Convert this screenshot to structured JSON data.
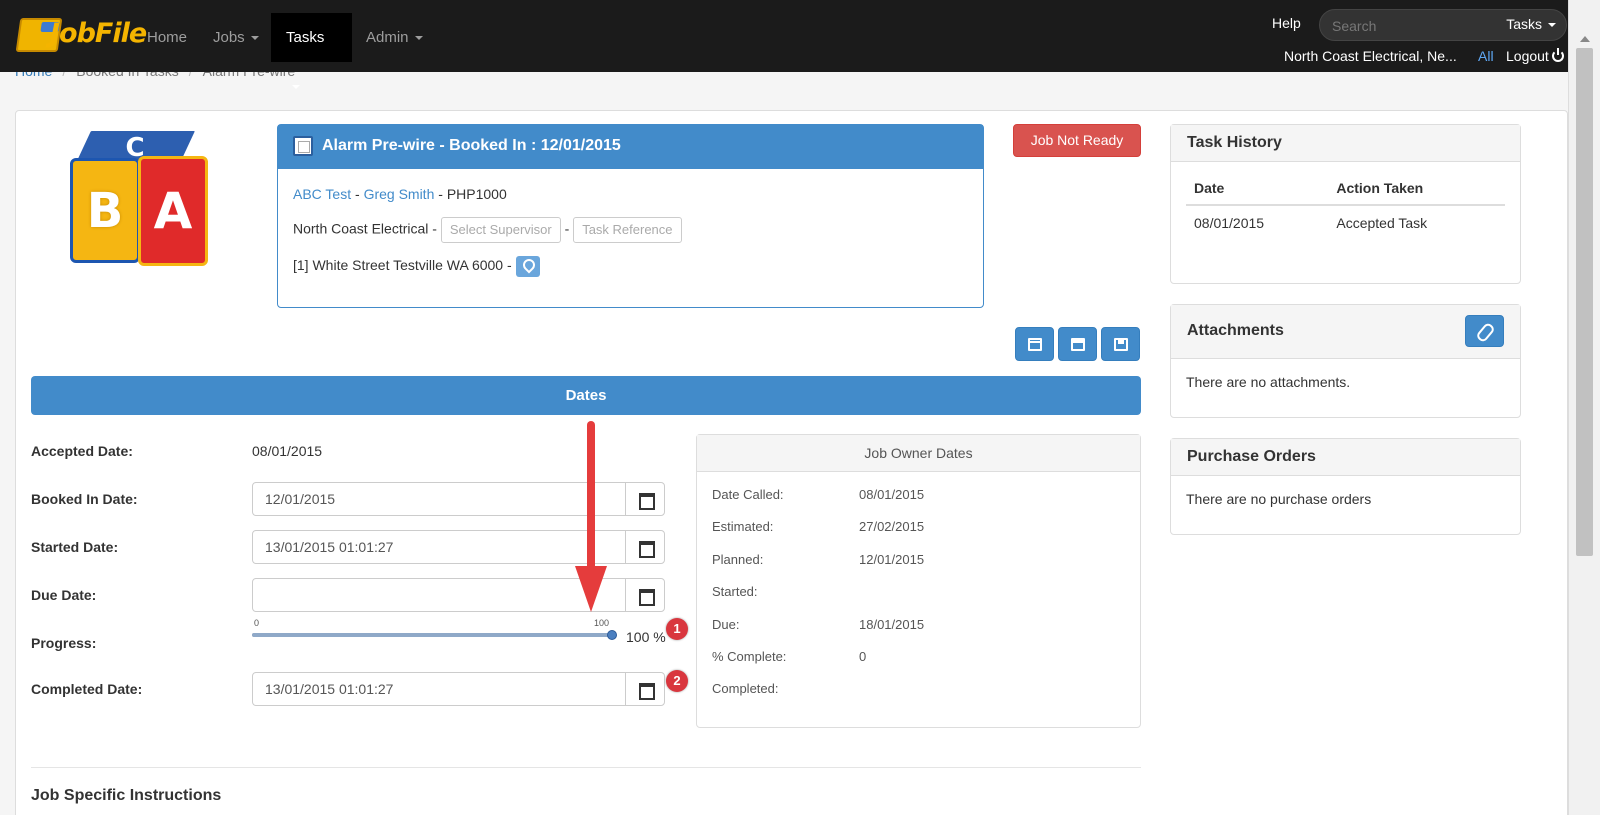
{
  "navbar": {
    "brand": "JobFile",
    "items": [
      {
        "label": "Home",
        "dropdown": false
      },
      {
        "label": "Jobs",
        "dropdown": true
      },
      {
        "label": "Tasks",
        "dropdown": true,
        "active": true
      },
      {
        "label": "Admin",
        "dropdown": true
      }
    ],
    "help": "Help",
    "search_placeholder": "Search",
    "search_scope": "Tasks",
    "company": "North Coast Electrical, Ne...",
    "all_link": "All",
    "logout": "Logout"
  },
  "breadcrumb": [
    "Home",
    "Booked In Tasks",
    "Alarm Pre-wire"
  ],
  "task": {
    "title": "Alarm Pre-wire - Booked In : 12/01/2015",
    "client": "ABC Test",
    "contact": "Greg Smith",
    "code": "PHP1000",
    "company": "North Coast Electrical",
    "supervisor_placeholder": "Select Supervisor",
    "reference_placeholder": "Task Reference",
    "address": "[1] White Street Testville WA 6000",
    "logo_letters": {
      "top": "C",
      "left": "B",
      "right": "A"
    }
  },
  "status_button": "Job Not Ready",
  "toolbar_icons": [
    "calendar-icon",
    "print-icon",
    "save-icon"
  ],
  "dates": {
    "section_title": "Dates",
    "accepted_label": "Accepted Date:",
    "accepted_value": "08/01/2015",
    "booked_label": "Booked In Date:",
    "booked_value": "12/01/2015",
    "started_label": "Started Date:",
    "started_value": "13/01/2015 01:01:27",
    "due_label": "Due Date:",
    "due_value": "",
    "progress_label": "Progress:",
    "progress_min": "0",
    "progress_max": "100",
    "progress_value": 100,
    "progress_text": "100 %",
    "completed_label": "Completed Date:",
    "completed_value": "13/01/2015 01:01:27"
  },
  "annotations": [
    "1",
    "2"
  ],
  "owner_dates": {
    "title": "Job Owner Dates",
    "rows": [
      {
        "label": "Date Called:",
        "value": "08/01/2015"
      },
      {
        "label": "Estimated:",
        "value": "27/02/2015"
      },
      {
        "label": "Planned:",
        "value": "12/01/2015"
      },
      {
        "label": "Started:",
        "value": ""
      },
      {
        "label": "Due:",
        "value": "18/01/2015"
      },
      {
        "label": "% Complete:",
        "value": "0"
      },
      {
        "label": "Completed:",
        "value": ""
      }
    ]
  },
  "task_history": {
    "title": "Task History",
    "columns": [
      "Date",
      "Action Taken"
    ],
    "rows": [
      [
        "08/01/2015",
        "Accepted Task"
      ]
    ]
  },
  "attachments": {
    "title": "Attachments",
    "empty_text": "There are no attachments."
  },
  "purchase_orders": {
    "title": "Purchase Orders",
    "empty_text": "There are no purchase orders"
  },
  "instructions_title": "Job Specific Instructions",
  "colors": {
    "primary": "#428bca",
    "danger": "#d9534f",
    "navbar": "#1b1b1b",
    "annotation": "#e53c3c"
  }
}
